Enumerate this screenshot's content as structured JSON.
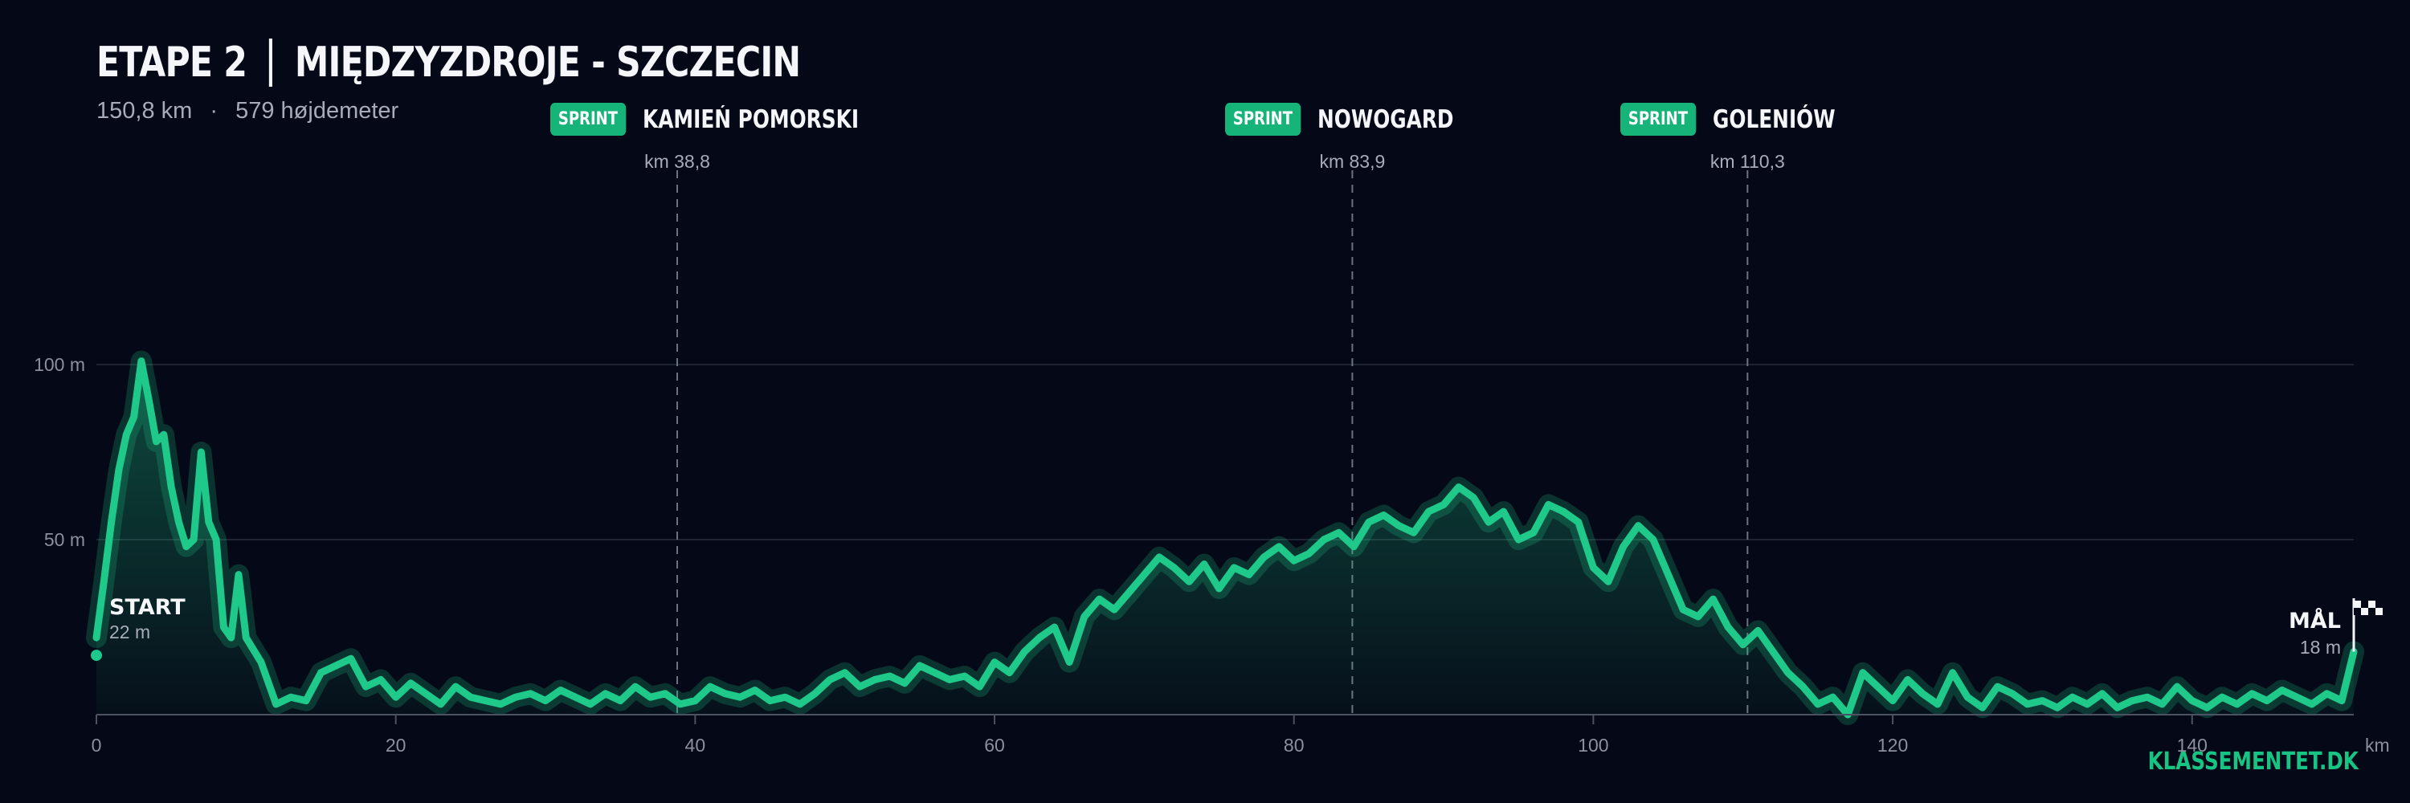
{
  "header": {
    "stage": "ETAPE 2",
    "route": "MIĘDZYZDROJE - SZCZECIN",
    "distance": "150,8 km",
    "separator": "·",
    "climbing": "579 højdemeter"
  },
  "brand": "KLASSEMENTET.DK",
  "colors": {
    "background": "#050816",
    "profile_line": "#1ec98a",
    "accent": "#17b47a",
    "grid": "#1e2433",
    "dashed": "#6b7280"
  },
  "sprints": [
    {
      "badge": "SPRINT",
      "name": "KAMIEŃ POMORSKI",
      "km": 38.8,
      "km_label": "km 38,8"
    },
    {
      "badge": "SPRINT",
      "name": "NOWOGARD",
      "km": 83.9,
      "km_label": "km 83,9"
    },
    {
      "badge": "SPRINT",
      "name": "GOLENIÓW",
      "km": 110.3,
      "km_label": "km 110,3"
    }
  ],
  "start": {
    "label": "START",
    "elevation_label": "22 m",
    "km": 0,
    "elevation": 22
  },
  "finish": {
    "label": "MÅL",
    "elevation_label": "18 m",
    "km": 150.8,
    "elevation": 18
  },
  "chart_data": {
    "type": "area",
    "title": "ETAPE 2 | MIĘDZYZDROJE - SZCZECIN",
    "xlabel": "km",
    "ylabel": "",
    "xlim": [
      0,
      150.8
    ],
    "ylim": [
      0,
      101
    ],
    "x_ticks": [
      0,
      20,
      40,
      60,
      80,
      100,
      120,
      140
    ],
    "y_ticks": [
      {
        "value": 50,
        "label": "50 m"
      },
      {
        "value": 100,
        "label": "100 m"
      }
    ],
    "grid": true,
    "x": [
      0,
      0.5,
      1,
      1.5,
      2,
      2.5,
      3,
      3.5,
      4,
      4.5,
      5,
      5.5,
      6,
      6.5,
      7,
      7.5,
      8,
      8.5,
      9,
      9.5,
      10,
      11,
      12,
      13,
      14,
      15,
      16,
      17,
      18,
      19,
      20,
      21,
      22,
      23,
      24,
      25,
      26,
      27,
      28,
      29,
      30,
      31,
      32,
      33,
      34,
      35,
      36,
      37,
      38,
      39,
      40,
      41,
      42,
      43,
      44,
      45,
      46,
      47,
      48,
      49,
      50,
      51,
      52,
      53,
      54,
      55,
      56,
      57,
      58,
      59,
      60,
      61,
      62,
      63,
      64,
      65,
      66,
      67,
      68,
      69,
      70,
      71,
      72,
      73,
      74,
      75,
      76,
      77,
      78,
      79,
      80,
      81,
      82,
      83,
      84,
      85,
      86,
      87,
      88,
      89,
      90,
      91,
      92,
      93,
      94,
      95,
      96,
      97,
      98,
      99,
      100,
      101,
      102,
      103,
      104,
      105,
      106,
      107,
      108,
      109,
      110,
      111,
      112,
      113,
      114,
      115,
      116,
      117,
      118,
      119,
      120,
      121,
      122,
      123,
      124,
      125,
      126,
      127,
      128,
      129,
      130,
      131,
      132,
      133,
      134,
      135,
      136,
      137,
      138,
      139,
      140,
      141,
      142,
      143,
      144,
      145,
      146,
      147,
      148,
      149,
      150,
      150.8
    ],
    "y": [
      22,
      38,
      55,
      70,
      80,
      85,
      101,
      90,
      78,
      80,
      65,
      55,
      48,
      50,
      75,
      55,
      50,
      25,
      22,
      40,
      22,
      15,
      3,
      5,
      4,
      12,
      14,
      16,
      8,
      10,
      5,
      9,
      6,
      3,
      8,
      5,
      4,
      3,
      5,
      6,
      4,
      7,
      5,
      3,
      6,
      4,
      8,
      5,
      6,
      3,
      4,
      8,
      6,
      5,
      7,
      4,
      5,
      3,
      6,
      10,
      12,
      8,
      10,
      11,
      9,
      14,
      12,
      10,
      11,
      8,
      15,
      12,
      18,
      22,
      25,
      15,
      28,
      33,
      30,
      35,
      40,
      45,
      42,
      38,
      43,
      36,
      42,
      40,
      45,
      48,
      44,
      46,
      50,
      52,
      48,
      55,
      57,
      54,
      52,
      58,
      60,
      65,
      62,
      55,
      58,
      50,
      52,
      60,
      58,
      55,
      42,
      38,
      48,
      54,
      50,
      40,
      30,
      28,
      33,
      25,
      20,
      24,
      18,
      12,
      8,
      3,
      5,
      0,
      12,
      8,
      4,
      10,
      6,
      3,
      12,
      5,
      2,
      8,
      6,
      3,
      4,
      2,
      5,
      3,
      6,
      2,
      4,
      5,
      3,
      8,
      4,
      2,
      5,
      3,
      6,
      4,
      7,
      5,
      3,
      6,
      4,
      18
    ]
  }
}
